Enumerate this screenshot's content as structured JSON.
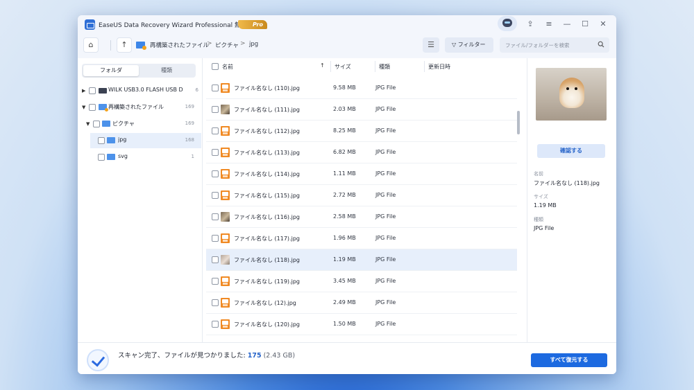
{
  "app": {
    "title": "EaseUS Data Recovery Wizard Professional 無期限",
    "badge": "Pro"
  },
  "window_controls": {
    "upload_icon": "⇪",
    "menu_icon": "≡",
    "minimize_icon": "—",
    "maximize_icon": "☐",
    "close_icon": "✕"
  },
  "toolbar": {
    "home_icon": "⌂",
    "up_icon": "↑",
    "breadcrumb": [
      "再構築されたファイル",
      "ピクチャ",
      "jpg"
    ],
    "breadcrumb_sep": ">",
    "view_icon": "☰",
    "filter_icon": "▽",
    "filter_label": "フィルター",
    "search_placeholder": "ファイル/フォルダーを検索"
  },
  "sidebar": {
    "tabs": [
      "フォルダ",
      "種類"
    ],
    "tree": [
      {
        "label": "WILK USB3.0 FLASH USB D",
        "count": "6"
      },
      {
        "label": "再構築されたファイル",
        "count": "169"
      },
      {
        "label": "ピクチャ",
        "count": "169"
      },
      {
        "label": "jpg",
        "count": "168"
      },
      {
        "label": "svg",
        "count": "1"
      }
    ]
  },
  "table": {
    "columns": [
      "名前",
      "サイズ",
      "種類",
      "更新日時"
    ],
    "sort_indicator": "↑",
    "rows": [
      {
        "name": "ファイル名なし (110).jpg",
        "size": "9.58 MB",
        "type": "JPG File"
      },
      {
        "name": "ファイル名なし (111).jpg",
        "size": "2.03 MB",
        "type": "JPG File"
      },
      {
        "name": "ファイル名なし (112).jpg",
        "size": "8.25 MB",
        "type": "JPG File"
      },
      {
        "name": "ファイル名なし (113).jpg",
        "size": "6.82 MB",
        "type": "JPG File"
      },
      {
        "name": "ファイル名なし (114).jpg",
        "size": "1.11 MB",
        "type": "JPG File"
      },
      {
        "name": "ファイル名なし (115).jpg",
        "size": "2.72 MB",
        "type": "JPG File"
      },
      {
        "name": "ファイル名なし (116).jpg",
        "size": "2.58 MB",
        "type": "JPG File"
      },
      {
        "name": "ファイル名なし (117).jpg",
        "size": "1.96 MB",
        "type": "JPG File"
      },
      {
        "name": "ファイル名なし (118).jpg",
        "size": "1.19 MB",
        "type": "JPG File"
      },
      {
        "name": "ファイル名なし (119).jpg",
        "size": "3.45 MB",
        "type": "JPG File"
      },
      {
        "name": "ファイル名なし (12).jpg",
        "size": "2.49 MB",
        "type": "JPG File"
      },
      {
        "name": "ファイル名なし (120).jpg",
        "size": "1.50 MB",
        "type": "JPG File"
      }
    ]
  },
  "preview": {
    "confirm_label": "確認する",
    "name_label": "名前",
    "name_value": "ファイル名なし (118).jpg",
    "size_label": "サイズ",
    "size_value": "1.19 MB",
    "type_label": "種類",
    "type_value": "JPG File"
  },
  "footer": {
    "status_text": "スキャン完了、ファイルが見つかりました: ",
    "count": "175",
    "size": " (2.43 GB)",
    "recover_label": "すべて復元する"
  },
  "colors": {
    "accent": "#1d6ae0",
    "selection": "#e7effb",
    "folder": "#4d92ea",
    "file_icon": "#f08a24"
  }
}
